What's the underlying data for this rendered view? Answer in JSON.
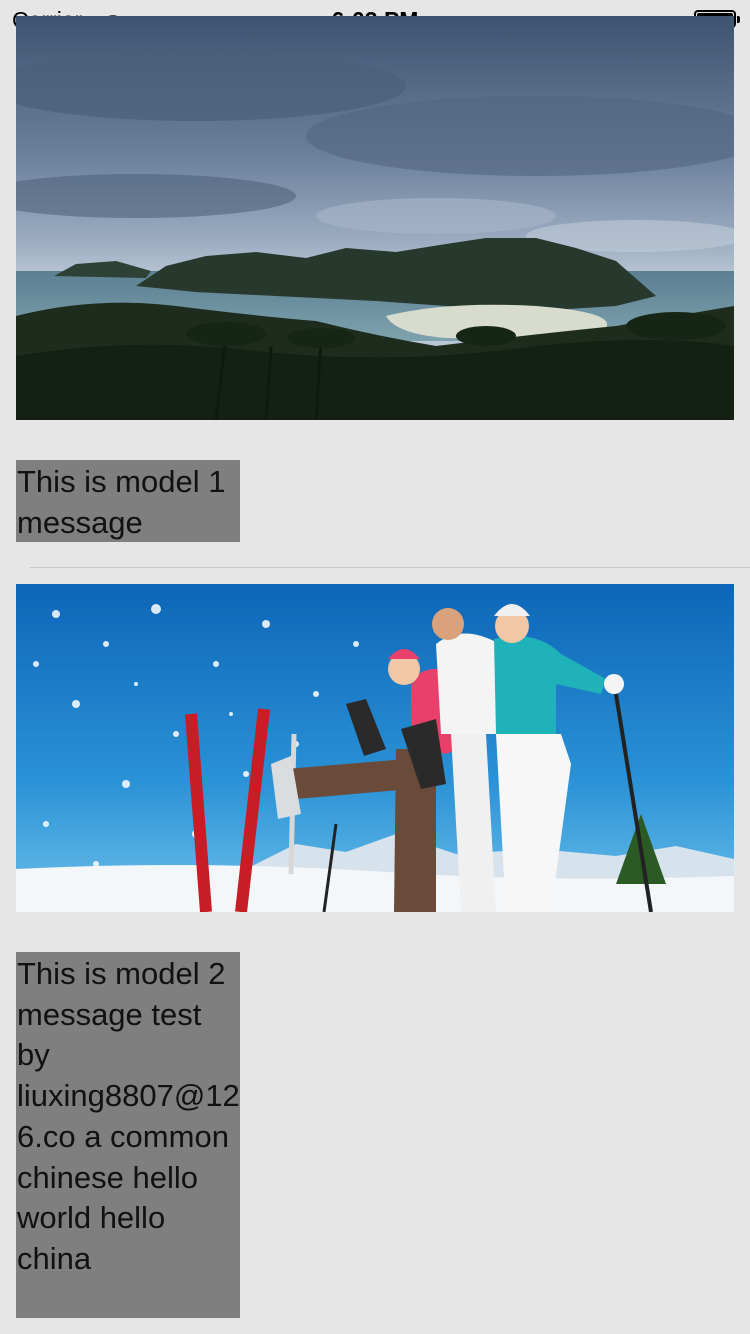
{
  "status_bar": {
    "carrier": "Carrier",
    "time": "6:03 PM",
    "battery_level": 1.0
  },
  "cells": [
    {
      "image_subject": "tropical island bay under cloudy sky",
      "message": "This is model 1 message"
    },
    {
      "image_subject": "three skiers posing in snow with skis and poles",
      "message": "This is model 2 message test by liuxing8807@126.co a common chinese hello world hello china"
    }
  ],
  "colors": {
    "background": "#e6e6e6",
    "message_background": "#7f7f7f",
    "separator": "#c8c8cc"
  }
}
